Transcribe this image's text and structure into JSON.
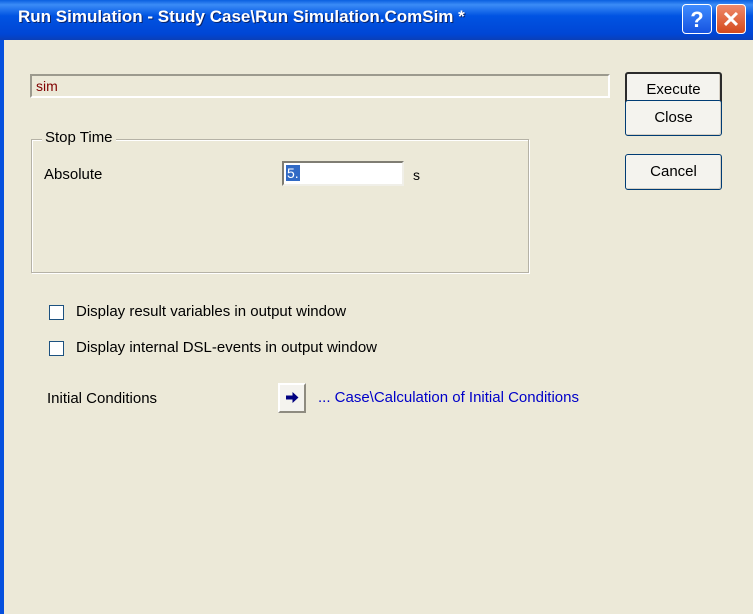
{
  "window": {
    "title": "Run Simulation - Study Case\\Run Simulation.ComSim *",
    "help_glyph": "?",
    "close_glyph": "✕"
  },
  "name_field": {
    "value": "sim"
  },
  "stop_time": {
    "group_label": "Stop Time",
    "absolute_label": "Absolute",
    "value": "5.",
    "unit": "s"
  },
  "buttons": {
    "execute": "Execute",
    "close": "Close",
    "cancel": "Cancel"
  },
  "options": {
    "display_result": {
      "label": "Display result variables in output window",
      "checked": false
    },
    "display_dsl": {
      "label": "Display internal DSL-events in output window",
      "checked": false
    }
  },
  "initial_conditions": {
    "label": "Initial Conditions",
    "link": "... Case\\Calculation of Initial Conditions",
    "arrow_icon": "right-arrow-icon"
  },
  "colors": {
    "titlebar": "#0053e2",
    "link": "#0000c8",
    "name_text": "#800000",
    "selection": "#316ac5"
  }
}
